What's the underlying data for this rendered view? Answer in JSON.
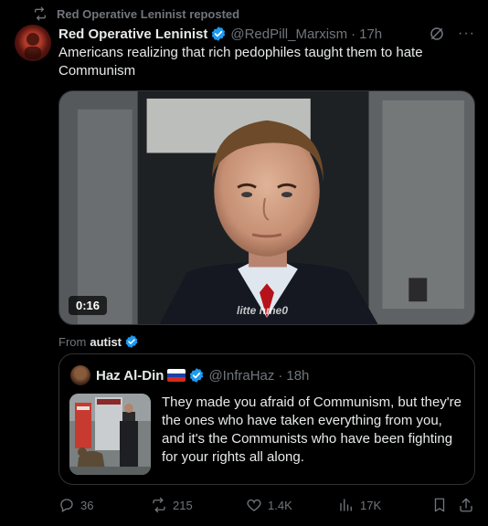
{
  "repost": {
    "label": "Red Operative Leninist reposted",
    "icon": "repost-icon"
  },
  "tweet": {
    "author_name": "Red Operative Leninist",
    "handle": "@RedPill_Marxism",
    "separator": "·",
    "time": "17h",
    "more": "···",
    "text": "Americans realizing that rich pedophiles taught them to hate Communism",
    "video": {
      "duration": "0:16",
      "watermark": "litte​ nme0"
    }
  },
  "from": {
    "prefix": "From",
    "author": "autist"
  },
  "quote": {
    "author_name": "Haz Al-Din",
    "handle": "@InfraHaz",
    "separator": "·",
    "time": "18h",
    "text": "They made you afraid of Communism, but they're the ones who have taken everything from you, and it's the Communists who have been fighting for your rights all along.",
    "flag": [
      "#ffffff",
      "#1c3fa8",
      "#d52b1e"
    ]
  },
  "actions": {
    "replies": "36",
    "reposts": "215",
    "likes": "1.4K",
    "views": "17K"
  },
  "colors": {
    "background": "#000000",
    "text": "#e7e9ea",
    "muted": "#71767b",
    "verified": "#1d9bf0",
    "border": "#2f3336"
  }
}
